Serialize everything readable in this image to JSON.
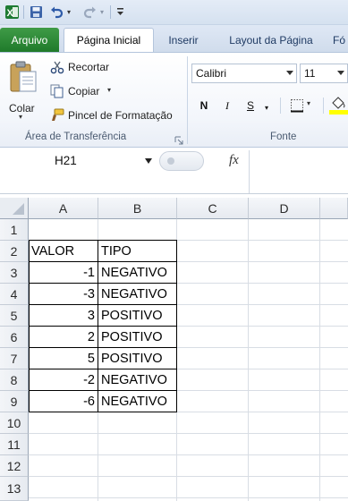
{
  "quick_access": {
    "app_icon": "excel-icon",
    "items": [
      "save-icon",
      "undo-icon",
      "redo-icon",
      "customize-icon"
    ]
  },
  "tabs": [
    {
      "label": "Arquivo",
      "kind": "file"
    },
    {
      "label": "Página Inicial",
      "kind": "active"
    },
    {
      "label": "Inserir",
      "kind": "normal"
    },
    {
      "label": "Layout da Página",
      "kind": "normal"
    },
    {
      "label": "Fó",
      "kind": "normal"
    }
  ],
  "clipboard": {
    "paste_label": "Colar",
    "cut_label": "Recortar",
    "copy_label": "Copiar",
    "format_painter_label": "Pincel de Formatação",
    "group_label": "Área de Transferência"
  },
  "font": {
    "family_value": "Calibri",
    "size_value": "11",
    "bold_label": "N",
    "italic_label": "I",
    "underline_label": "S",
    "group_label": "Fonte",
    "fill_color": "#ffff00"
  },
  "formula_bar": {
    "name_box": "H21",
    "fx_label": "fx",
    "formula": ""
  },
  "sheet": {
    "columns": [
      "A",
      "B",
      "C",
      "D"
    ],
    "rows": [
      "1",
      "2",
      "3",
      "4",
      "5",
      "6",
      "7",
      "8",
      "9",
      "10",
      "11",
      "12",
      "13"
    ],
    "table": {
      "header": [
        "VALOR",
        "TIPO"
      ],
      "records": [
        [
          "-1",
          "NEGATIVO"
        ],
        [
          "-3",
          "NEGATIVO"
        ],
        [
          "3",
          "POSITIVO"
        ],
        [
          "2",
          "POSITIVO"
        ],
        [
          "5",
          "POSITIVO"
        ],
        [
          "-2",
          "NEGATIVO"
        ],
        [
          "-6",
          "NEGATIVO"
        ]
      ]
    }
  }
}
